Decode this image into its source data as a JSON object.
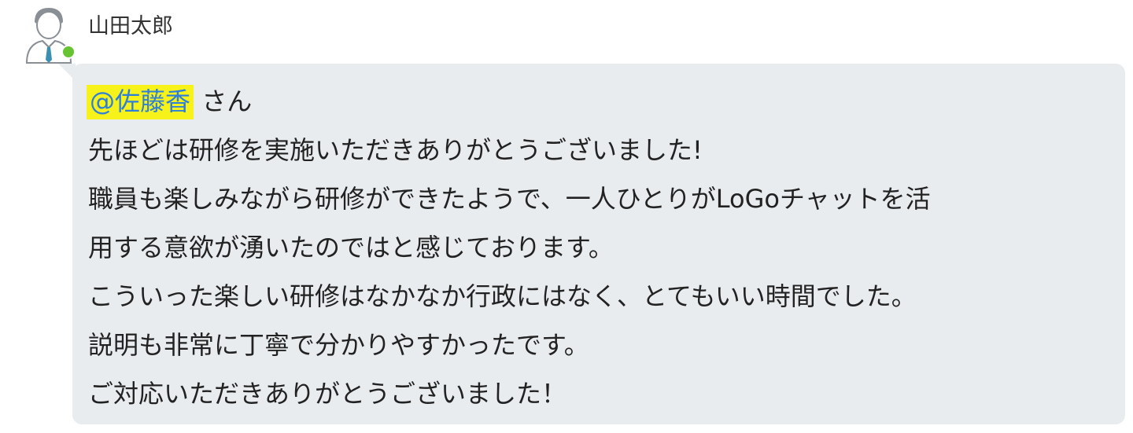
{
  "message": {
    "sender": "山田太郎",
    "status_color": "#66c332",
    "mention": "@佐藤香",
    "mention_suffix": " さん",
    "lines": [
      "先ほどは研修を実施いただきありがとうございました!",
      "職員も楽しみながら研修ができたようで、一人ひとりがLoGoチャットを活",
      "用する意欲が湧いたのではと感じております。",
      "こういった楽しい研修はなかなか行政にはなく、とてもいい時間でした。",
      "説明も非常に丁寧で分かりやすかったです。",
      "ご対応いただきありがとうございました！"
    ]
  }
}
